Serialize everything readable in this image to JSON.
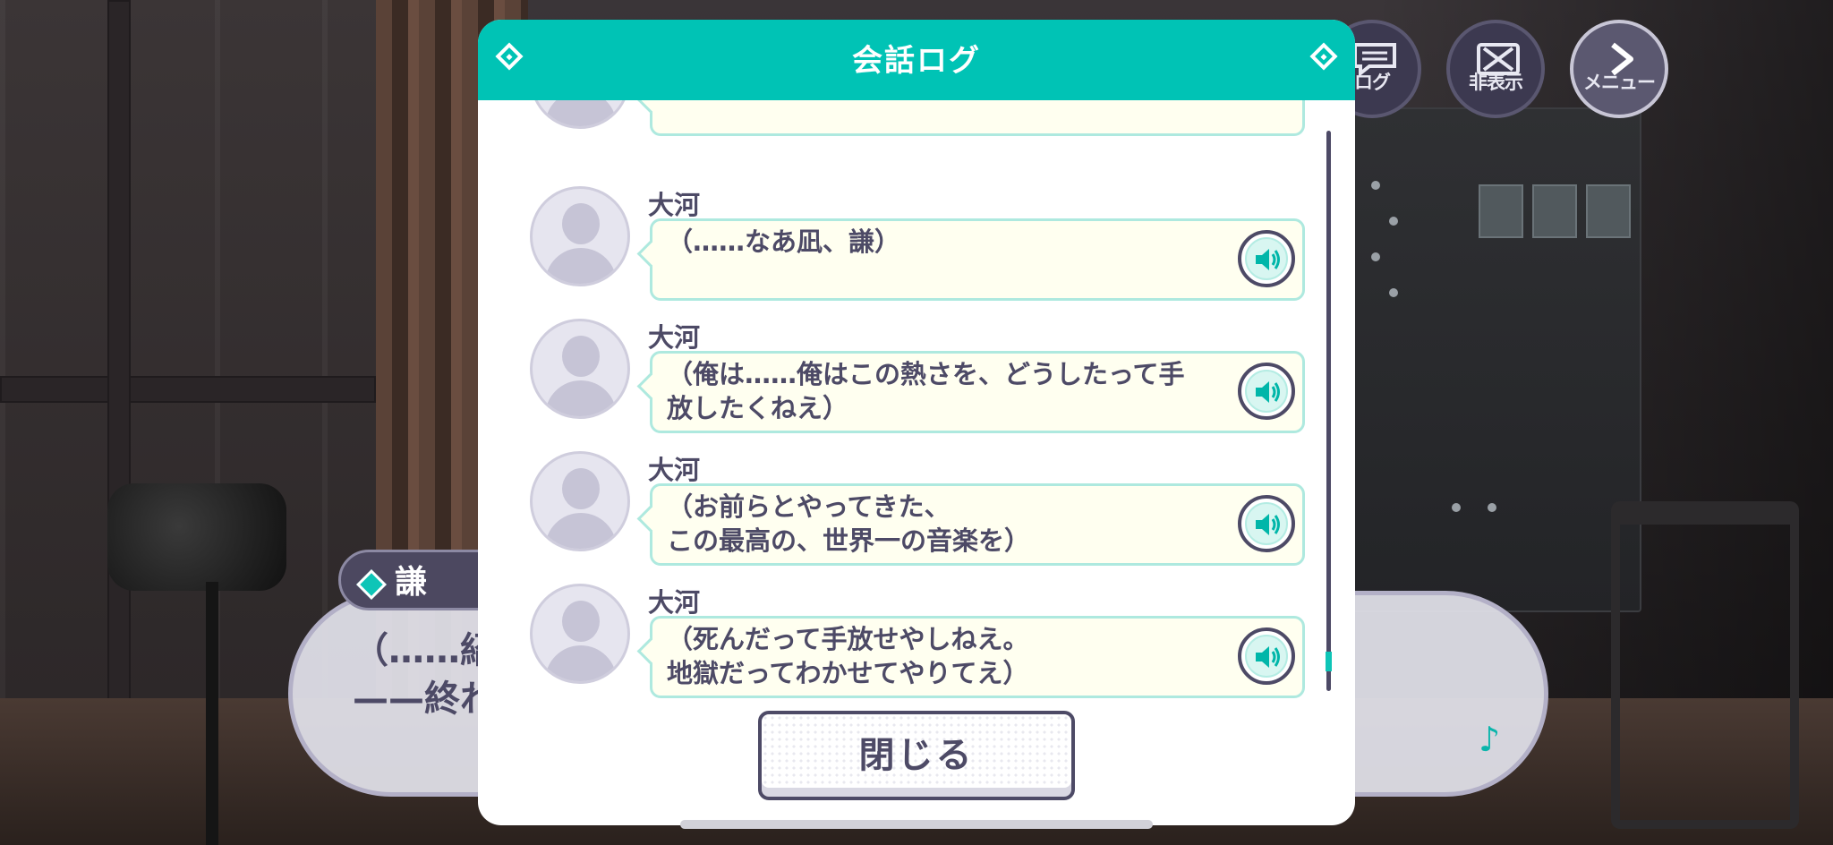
{
  "hud": {
    "log_label": "ログ",
    "hide_label": "非表示",
    "menu_label": "メニュー"
  },
  "dialogue": {
    "speaker": "謙",
    "line1": "（……紹",
    "line2": "——終わ"
  },
  "log_modal": {
    "title": "会話ログ",
    "entries": [
      {
        "speaker": "大河",
        "text": "（……なあ凪、謙）"
      },
      {
        "speaker": "大河",
        "text": "（俺は……俺はこの熱さを、どうしたって手\n放したくねえ）"
      },
      {
        "speaker": "大河",
        "text": "（お前らとやってきた、\nこの最高の、世界一の音楽を）"
      },
      {
        "speaker": "大河",
        "text": "（死んだって手放せやしねえ。\n地獄だってわかせてやりてえ）"
      }
    ],
    "close_label": "閉じる"
  },
  "colors": {
    "accent": "#00c3b5",
    "text": "#4d4a66",
    "bubble_bg": "#fffff0",
    "bubble_border": "#aee9df"
  }
}
